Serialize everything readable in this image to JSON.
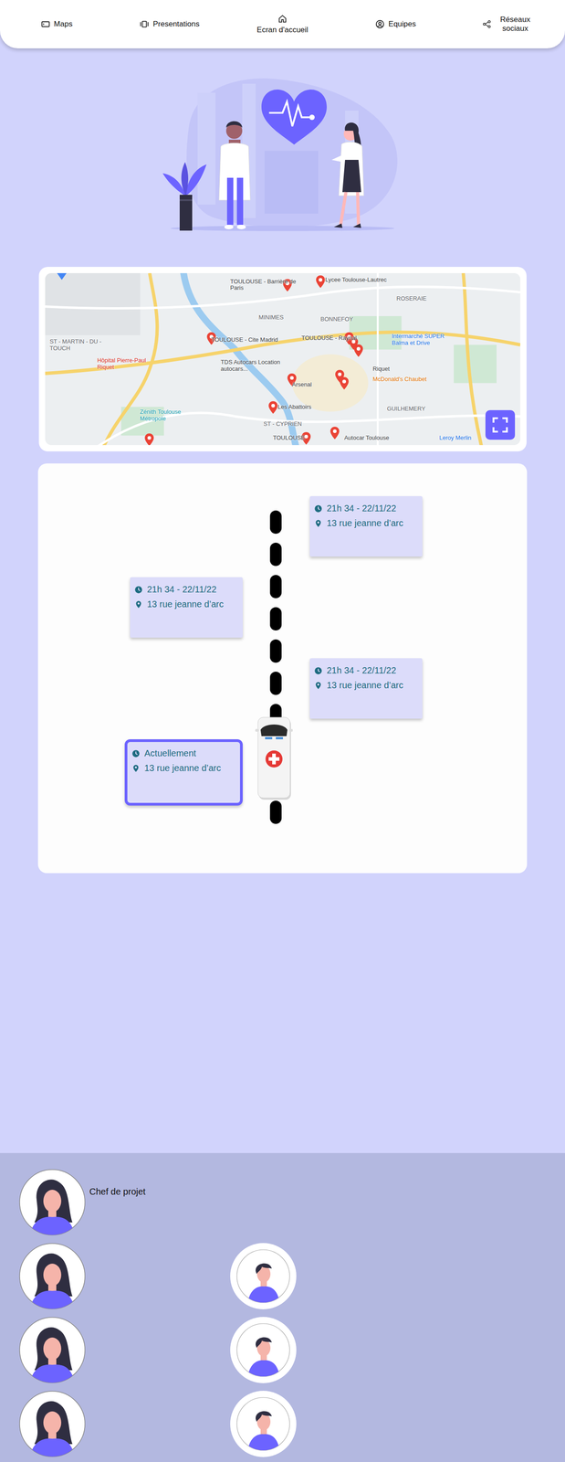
{
  "nav": [
    {
      "label": "Maps",
      "selected": false
    },
    {
      "label": "Presentations",
      "selected": false
    },
    {
      "label": "Ecran d'accueil",
      "selected": true
    },
    {
      "label": "Equipes",
      "selected": false
    },
    {
      "label": "Réseaux sociaux",
      "selected": false
    }
  ],
  "map": {
    "labels": [
      {
        "text": "TOULOUSE - Barrière de Paris",
        "color": "#3c4043"
      },
      {
        "text": "Lycee Toulouse-Lautrec",
        "color": "#3c4043"
      },
      {
        "text": "ROSERAIE",
        "color": "#5f6368"
      },
      {
        "text": "MINIMES",
        "color": "#5f6368"
      },
      {
        "text": "BONNEFOY",
        "color": "#5f6368"
      },
      {
        "text": "ST - MARTIN - DU - TOUCH",
        "color": "#5f6368"
      },
      {
        "text": "TOULOUSE - Cite Madrid",
        "color": "#3c4043"
      },
      {
        "text": "TOULOUSE - Raynal",
        "color": "#3c4043"
      },
      {
        "text": "Intermarché SUPER Balma et Drive",
        "color": "#1a73e8"
      },
      {
        "text": "Hôpital Pierre-Paul Riquet",
        "color": "#d93025"
      },
      {
        "text": "TDS Autocars Location autocars...",
        "color": "#3c4043"
      },
      {
        "text": "Riquet",
        "color": "#3c4043"
      },
      {
        "text": "Arsenal",
        "color": "#3c4043"
      },
      {
        "text": "McDonald's Chaubet",
        "color": "#e37400"
      },
      {
        "text": "Zénith Toulouse Métropole",
        "color": "#129eaf"
      },
      {
        "text": "Les Abattoirs",
        "color": "#3c4043"
      },
      {
        "text": "GUILHEMERY",
        "color": "#5f6368"
      },
      {
        "text": "ST - CYPRIEN",
        "color": "#5f6368"
      },
      {
        "text": "TOULOUSE",
        "color": "#3c4043"
      },
      {
        "text": "Autocar Toulouse",
        "color": "#3c4043"
      },
      {
        "text": "Leroy Merlin",
        "color": "#1a73e8"
      }
    ]
  },
  "timeline": {
    "stops": [
      {
        "time": "21h 34 - 22/11/22",
        "address": "13 rue jeanne d’arc",
        "current": false
      },
      {
        "time": "21h 34 - 22/11/22",
        "address": "13 rue jeanne d’arc",
        "current": false
      },
      {
        "time": "21h 34 - 22/11/22",
        "address": "13 rue jeanne d’arc",
        "current": false
      },
      {
        "time": "Actuellement",
        "address": "13 rue jeanne d’arc",
        "current": true
      }
    ]
  },
  "team": {
    "lead": {
      "role": "Chef de projet",
      "kind": "woman"
    },
    "members": [
      {
        "kind": "woman"
      },
      {
        "kind": "man"
      },
      {
        "kind": "woman"
      },
      {
        "kind": "man"
      },
      {
        "kind": "woman"
      },
      {
        "kind": "man"
      }
    ]
  }
}
